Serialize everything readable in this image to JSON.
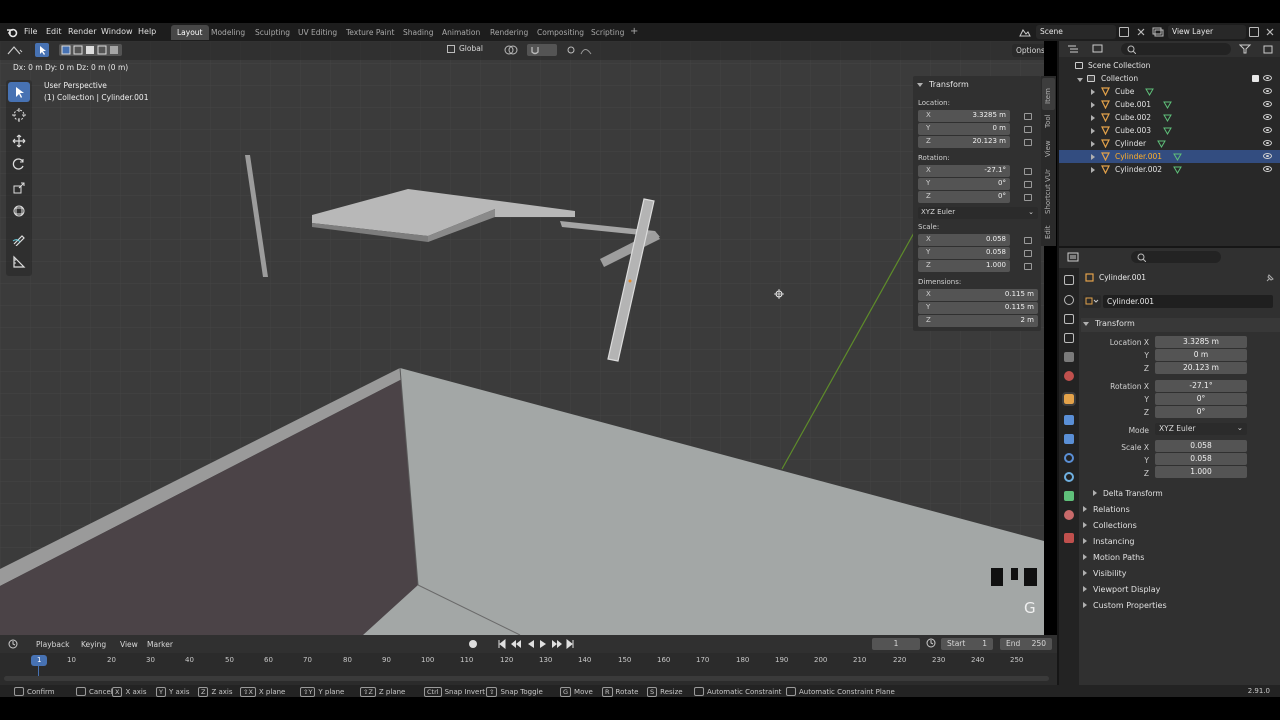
{
  "topbar": {
    "menu": [
      "File",
      "Edit",
      "Render",
      "Window",
      "Help"
    ],
    "workspaces": [
      "Layout",
      "Modeling",
      "Sculpting",
      "UV Editing",
      "Texture Paint",
      "Shading",
      "Animation",
      "Rendering",
      "Compositing",
      "Scripting"
    ],
    "active_workspace": "Layout",
    "add_tab": "+",
    "scene": "Scene",
    "view_layer": "View Layer"
  },
  "header": {
    "transform_orientation": "Global",
    "options_label": "Options",
    "transform_readout": "Dx: 0 m  Dy: 0 m  Dz: 0 m (0 m)"
  },
  "viewport": {
    "perspective": "User Perspective",
    "object_info": "(1) Collection | Cylinder.001",
    "keystroke_hint": "G"
  },
  "npanel": {
    "title": "Transform",
    "location_label": "Location:",
    "rotation_label": "Rotation:",
    "scale_label": "Scale:",
    "dimensions_label": "Dimensions:",
    "rotation_mode": "XYZ Euler",
    "location": [
      {
        "axis": "X",
        "value": "3.3285 m"
      },
      {
        "axis": "Y",
        "value": "0 m"
      },
      {
        "axis": "Z",
        "value": "20.123 m"
      }
    ],
    "rotation": [
      {
        "axis": "X",
        "value": "-27.1°"
      },
      {
        "axis": "Y",
        "value": "0°"
      },
      {
        "axis": "Z",
        "value": "0°"
      }
    ],
    "scale": [
      {
        "axis": "X",
        "value": "0.058"
      },
      {
        "axis": "Y",
        "value": "0.058"
      },
      {
        "axis": "Z",
        "value": "1.000"
      }
    ],
    "dimensions": [
      {
        "axis": "X",
        "value": "0.115 m"
      },
      {
        "axis": "Y",
        "value": "0.115 m"
      },
      {
        "axis": "Z",
        "value": "2 m"
      }
    ],
    "side_tabs": [
      "Item",
      "Tool",
      "View",
      "Shortcut VUr",
      "Edit"
    ]
  },
  "outliner": {
    "scene_collection": "Scene Collection",
    "collection": "Collection",
    "objects": [
      {
        "name": "Cube",
        "selected": false
      },
      {
        "name": "Cube.001",
        "selected": false
      },
      {
        "name": "Cube.002",
        "selected": false
      },
      {
        "name": "Cube.003",
        "selected": false
      },
      {
        "name": "Cylinder",
        "selected": false
      },
      {
        "name": "Cylinder.001",
        "selected": true
      },
      {
        "name": "Cylinder.002",
        "selected": false
      }
    ]
  },
  "properties": {
    "object_name": "Cylinder.001",
    "datablock_name": "Cylinder.001",
    "transform_section": "Transform",
    "location_x_label": "Location X",
    "rotation_x_label": "Rotation X",
    "scale_x_label": "Scale X",
    "mode_label": "Mode",
    "y_label": "Y",
    "z_label": "Z",
    "location": [
      "3.3285 m",
      "0 m",
      "20.123 m"
    ],
    "rotation": [
      "-27.1°",
      "0°",
      "0°"
    ],
    "mode": "XYZ Euler",
    "scale": [
      "0.058",
      "0.058",
      "1.000"
    ],
    "delta_transform": "Delta Transform",
    "collapsed_sections": [
      "Relations",
      "Collections",
      "Instancing",
      "Motion Paths",
      "Visibility",
      "Viewport Display",
      "Custom Properties"
    ]
  },
  "timeline": {
    "menus": [
      "Playback",
      "Keying",
      "View",
      "Marker"
    ],
    "current_frame": "1",
    "start_label": "Start",
    "start": "1",
    "end_label": "End",
    "end": "250",
    "ruler": [
      "1",
      "10",
      "20",
      "30",
      "40",
      "50",
      "60",
      "70",
      "80",
      "90",
      "100",
      "110",
      "120",
      "130",
      "140",
      "150",
      "160",
      "170",
      "180",
      "190",
      "200",
      "210",
      "220",
      "230",
      "240",
      "250"
    ]
  },
  "statusbar": {
    "items": [
      {
        "key": "",
        "label": "Confirm"
      },
      {
        "key": "",
        "label": "Cancel"
      },
      {
        "key": "X",
        "label": "X axis"
      },
      {
        "key": "Y",
        "label": "Y axis"
      },
      {
        "key": "Z",
        "label": "Z axis"
      },
      {
        "key": "⇧X",
        "label": "X plane"
      },
      {
        "key": "⇧Y",
        "label": "Y plane"
      },
      {
        "key": "⇧Z",
        "label": "Z plane"
      },
      {
        "key": "Ctrl",
        "label": "Snap Invert"
      },
      {
        "key": "⇧",
        "label": "Snap Toggle"
      },
      {
        "key": "G",
        "label": "Move"
      },
      {
        "key": "R",
        "label": "Rotate"
      },
      {
        "key": "S",
        "label": "Resize"
      },
      {
        "key": "",
        "label": "Automatic Constraint"
      },
      {
        "key": "",
        "label": "Automatic Constraint Plane"
      }
    ],
    "version": "2.91.0"
  },
  "colors": {
    "selection": "#334d80",
    "accent": "#4772b3",
    "active_object_text": "#ffaf29",
    "y_axis": "#6f9f2b",
    "mesh_icon": "#e3a24a"
  }
}
